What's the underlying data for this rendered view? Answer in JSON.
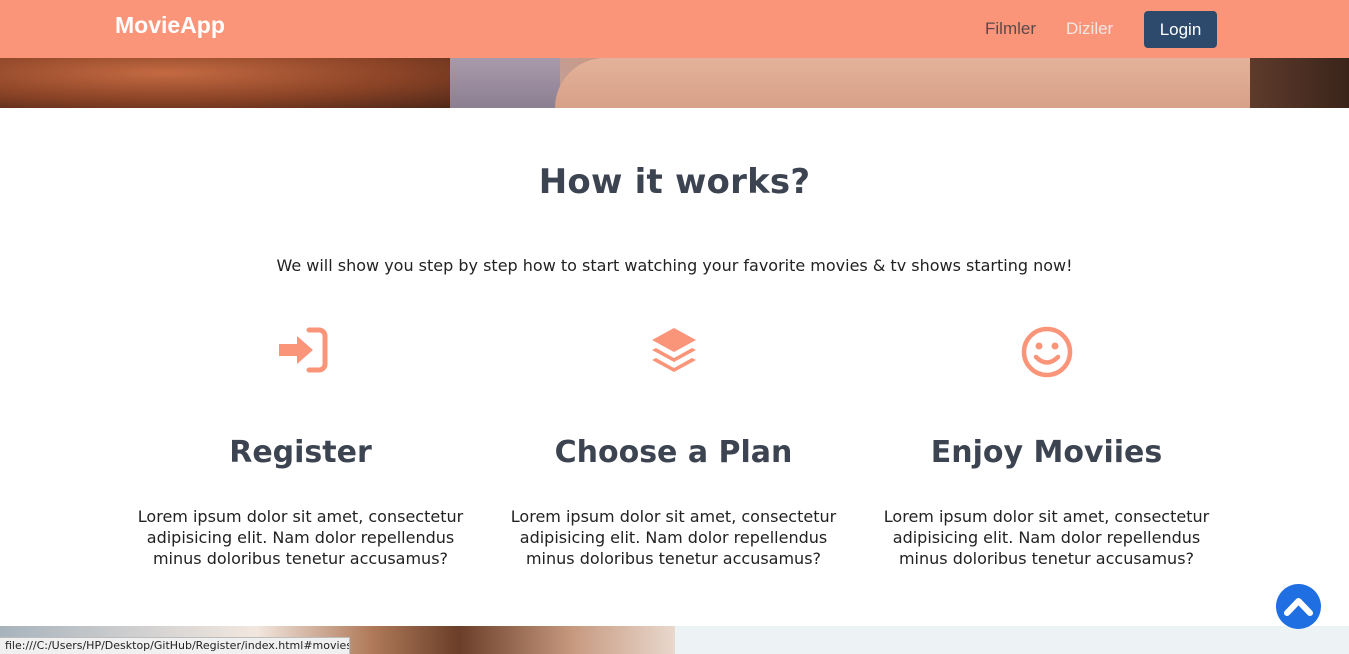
{
  "navbar": {
    "brand": "MovieApp",
    "links": [
      "Filmler",
      "Diziler"
    ],
    "login_label": "Login",
    "bg_color": "#fb957a",
    "login_color": "#2d4a6d"
  },
  "how_it_works": {
    "title": "How it works?",
    "subtitle": "We will show you step by step how to start watching your favorite movies & tv shows starting now!",
    "accent_color": "#fb957a",
    "steps": [
      {
        "icon": "sign-in-icon",
        "title": "Register",
        "description": "Lorem ipsum dolor sit amet, consectetur adipisicing elit. Nam dolor repellendus minus doloribus tenetur accusamus?"
      },
      {
        "icon": "layers-icon",
        "title": "Choose a Plan",
        "description": "Lorem ipsum dolor sit amet, consectetur adipisicing elit. Nam dolor repellendus minus doloribus tenetur accusamus?"
      },
      {
        "icon": "smile-icon",
        "title": "Enjoy Moviies",
        "description": "Lorem ipsum dolor sit amet, consectetur adipisicing elit. Nam dolor repellendus minus doloribus tenetur accusamus?"
      }
    ]
  },
  "scroll_top": {
    "icon": "chevron-up-icon",
    "color": "#1f6fe3"
  },
  "status_bar": {
    "url": "file:///C:/Users/HP/Desktop/GitHub/Register/index.html#movies"
  }
}
